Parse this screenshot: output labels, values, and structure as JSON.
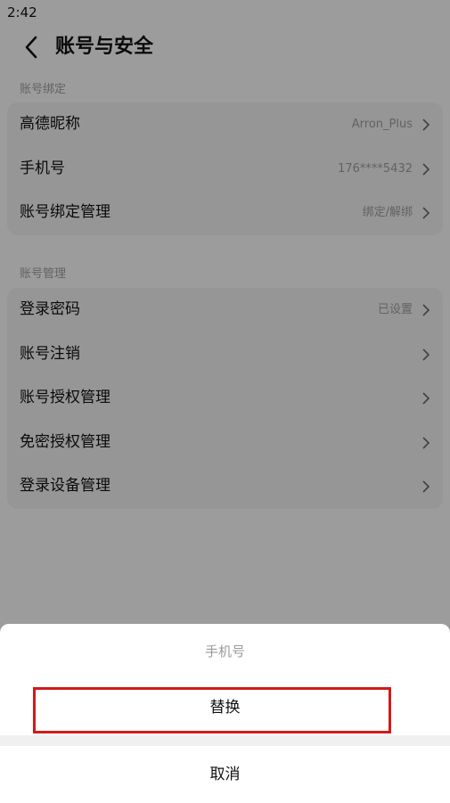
{
  "status_bar": {
    "time": "2:42"
  },
  "header": {
    "title": "账号与安全"
  },
  "sections": [
    {
      "label": "账号绑定",
      "rows": [
        {
          "label": "高德昵称",
          "value": "Arron_Plus"
        },
        {
          "label": "手机号",
          "value": "176****5432"
        },
        {
          "label": "账号绑定管理",
          "value": "绑定/解绑"
        }
      ]
    },
    {
      "label": "账号管理",
      "rows": [
        {
          "label": "登录密码",
          "value": "已设置"
        },
        {
          "label": "账号注销",
          "value": ""
        },
        {
          "label": "账号授权管理",
          "value": ""
        },
        {
          "label": "免密授权管理",
          "value": ""
        },
        {
          "label": "登录设备管理",
          "value": ""
        }
      ]
    }
  ],
  "action_sheet": {
    "title": "手机号",
    "option": "替换",
    "cancel": "取消"
  },
  "colors": {
    "highlight": "#d11a1a"
  }
}
